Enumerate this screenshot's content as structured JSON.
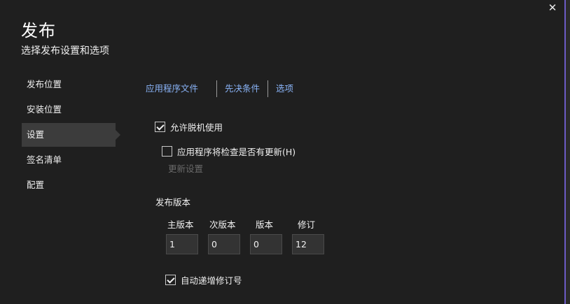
{
  "dialog": {
    "title": "发布",
    "subtitle": "选择发布设置和选项",
    "close_glyph": "✕"
  },
  "nav": {
    "items": [
      {
        "label": "发布位置"
      },
      {
        "label": "安装位置"
      },
      {
        "label": "设置"
      },
      {
        "label": "签名清单"
      },
      {
        "label": "配置"
      }
    ],
    "active_index": 2
  },
  "tabs": [
    "应用程序文件",
    "先决条件",
    "选项"
  ],
  "settings": {
    "allow_offline": {
      "label": "允许脱机使用",
      "checked": true
    },
    "check_updates": {
      "label": "应用程序将检查是否有更新(H)",
      "checked": false
    },
    "update_settings_link": "更新设置"
  },
  "version": {
    "section_label": "发布版本",
    "major": {
      "label": "主版本",
      "value": "1"
    },
    "minor": {
      "label": "次版本",
      "value": "0"
    },
    "build": {
      "label": "版本",
      "value": "0"
    },
    "revision": {
      "label": "修订",
      "value": "12"
    },
    "auto_increment": {
      "label": "自动递增修订号",
      "checked": true
    }
  },
  "colors": {
    "accent_border": "#6c5bc6",
    "tab_link": "#8ab4f8",
    "nav_active_bg": "#3c3c3c",
    "background": "#1f1f1f"
  }
}
